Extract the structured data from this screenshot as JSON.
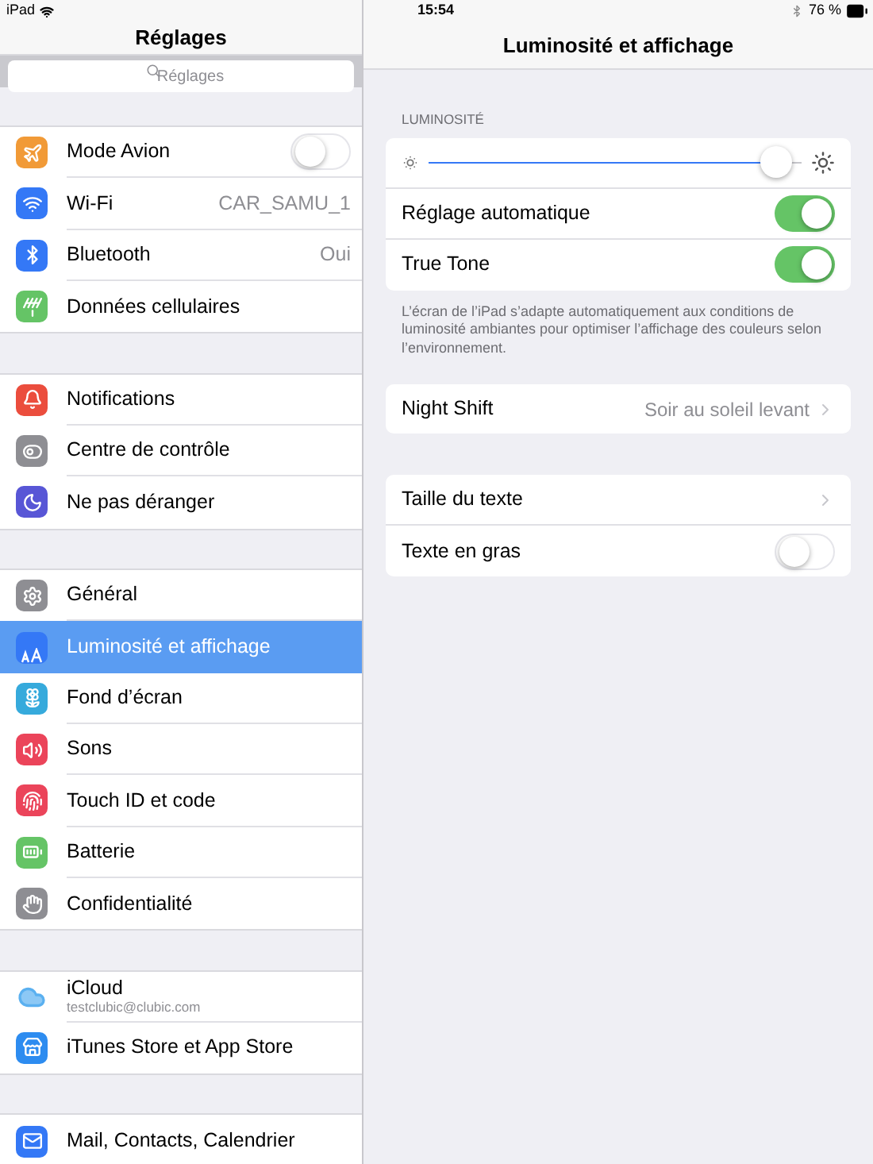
{
  "status_bar": {
    "device": "iPad",
    "time": "15:54",
    "battery": "76 %"
  },
  "sidebar": {
    "title": "Réglages",
    "search": {
      "placeholder": "Réglages"
    },
    "groups": [
      [
        {
          "label": "Mode Avion",
          "kind": "toggle",
          "on": false,
          "color": "#f19a37",
          "selected": false
        },
        {
          "label": "Wi-Fi",
          "kind": "value",
          "value": "CAR_SAMU_1",
          "color": "#3478f6",
          "selected": false
        },
        {
          "label": "Bluetooth",
          "kind": "value",
          "value": "Oui",
          "color": "#3478f6",
          "selected": false
        },
        {
          "label": "Données cellulaires",
          "kind": "plain",
          "color": "#65c466",
          "selected": false
        }
      ],
      [
        {
          "label": "Notifications",
          "kind": "plain",
          "color": "#eb4d3d",
          "selected": false
        },
        {
          "label": "Centre de contrôle",
          "kind": "plain",
          "color": "#8e8e93",
          "selected": false
        },
        {
          "label": "Ne pas déranger",
          "kind": "plain",
          "color": "#5856d6",
          "selected": false
        }
      ],
      [
        {
          "label": "Général",
          "kind": "plain",
          "color": "#8e8e93",
          "selected": false
        },
        {
          "label": "Luminosité et affichage",
          "kind": "plain",
          "color": "#3478f6",
          "selected": true
        },
        {
          "label": "Fond d’écran",
          "kind": "plain",
          "color": "#36aadc",
          "selected": false
        },
        {
          "label": "Sons",
          "kind": "plain",
          "color": "#eb445a",
          "selected": false
        },
        {
          "label": "Touch ID et code",
          "kind": "plain",
          "color": "#eb445a",
          "selected": false
        },
        {
          "label": "Batterie",
          "kind": "plain",
          "color": "#65c466",
          "selected": false
        },
        {
          "label": "Confidentialité",
          "kind": "plain",
          "color": "#8e8e93",
          "selected": false
        }
      ],
      [
        {
          "label": "iCloud",
          "kind": "account",
          "sublabel": "testclubic@clubic.com",
          "color": "#ffffff",
          "selected": false
        },
        {
          "label": "iTunes Store et App Store",
          "kind": "plain",
          "color": "#2d8cf0",
          "selected": false
        }
      ],
      [
        {
          "label": "Mail, Contacts, Calendrier",
          "kind": "plain",
          "color": "#3478f6",
          "selected": false
        }
      ]
    ]
  },
  "detail": {
    "title": "Luminosité et affichage",
    "section_header": "LUMINOSITÉ",
    "brightness": {
      "level": 0.93
    },
    "brightness_rows": [
      {
        "label": "Réglage automatique",
        "on": true
      },
      {
        "label": "True Tone",
        "on": true
      }
    ],
    "footnote": "L’écran de l’iPad s’adapte automatiquement aux conditions de luminosité ambiantes pour optimiser l’affichage des couleurs selon l’environnement.",
    "night_shift": {
      "label": "Night Shift",
      "value": "Soir au soleil levant"
    },
    "text_rows": [
      {
        "label": "Taille du texte",
        "kind": "link"
      },
      {
        "label": "Texte en gras",
        "kind": "toggle",
        "on": false
      }
    ]
  }
}
